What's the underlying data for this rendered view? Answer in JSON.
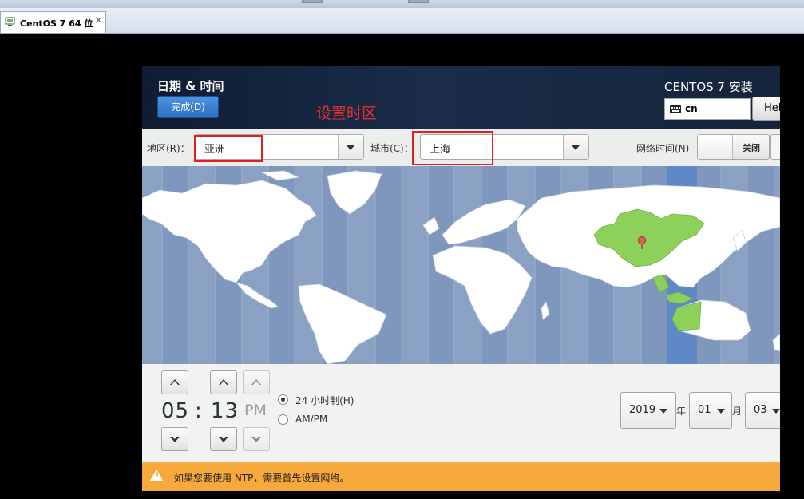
{
  "vm": {
    "tab_title": "CentOS 7 64 位",
    "tab_close": "×"
  },
  "header": {
    "title": "日期 & 时间",
    "done_label": "完成(D)",
    "annotation": "设置时区",
    "installer_title": "CENTOS 7 安装",
    "keyboard_layout": "cn",
    "help_label": "Help!"
  },
  "selectors": {
    "region_label": "地区(R)：",
    "region_value": "亚洲",
    "city_label": "城市(C)：",
    "city_value": "上海",
    "network_time_label": "网络时间(N)",
    "network_time_state": "关闭"
  },
  "time": {
    "hours": "05",
    "separator": ":",
    "minutes": "13",
    "ampm": "PM",
    "format_24h_label": "24 小时制(H)",
    "format_ampm_label": "AM/PM",
    "format_24h_selected": true
  },
  "date": {
    "year": "2019",
    "year_unit": "年",
    "month": "01",
    "month_unit": "月",
    "day": "03"
  },
  "warning": {
    "icon": "warning-icon",
    "text": "如果您要使用 NTP，需要首先设置网络。"
  },
  "colors": {
    "header_bg": "#16243c",
    "done_button": "#3a7fd5",
    "annotation": "#e8302a",
    "map_ocean": "#8aa1c4",
    "map_selected_zone": "#5e88c6",
    "map_land": "#ffffff",
    "map_selected_land": "#8dd05a",
    "warning_bg": "#f7a93c"
  }
}
